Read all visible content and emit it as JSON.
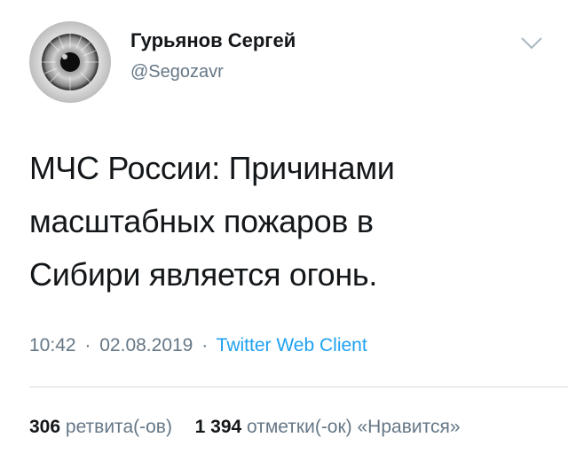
{
  "author": {
    "display_name": "Гурьянов Сергей",
    "handle": "@Segozavr",
    "avatar_icon": "eye-avatar",
    "menu_icon": "chevron-down-icon"
  },
  "tweet": {
    "lines": [
      "МЧС России: Причинами",
      "масштабных пожаров в",
      "Сибири является огонь."
    ]
  },
  "meta": {
    "time": "10:42",
    "separator": "·",
    "date": "02.08.2019",
    "client": "Twitter Web Client"
  },
  "stats": {
    "retweets_count": "306",
    "retweets_label": "ретвита(-ов)",
    "likes_count": "1 394",
    "likes_label": "отметки(-ок) «Нравится»"
  },
  "colors": {
    "text": "#14171a",
    "secondary": "#657786",
    "link": "#1da1f2",
    "divider": "#d6dbdf"
  }
}
